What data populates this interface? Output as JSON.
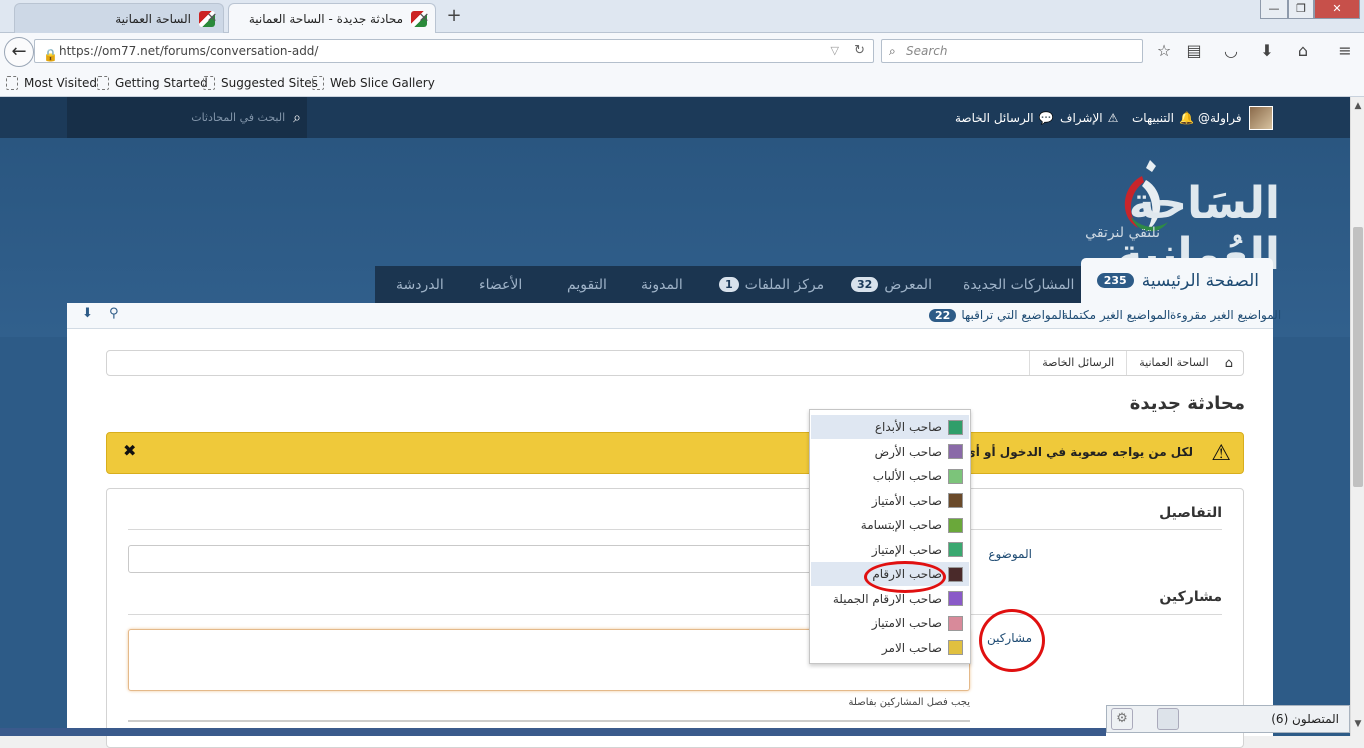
{
  "browser": {
    "tabs": [
      {
        "title": "الساحة العمانية",
        "active": false
      },
      {
        "title": "محادثة جديدة - الساحة العمانية",
        "active": true
      }
    ],
    "new_tab_symbol": "+",
    "window_controls": [
      "—",
      "❐",
      "✕"
    ],
    "url": "https://om77.net/forums/conversation-add/",
    "search_placeholder": "Search",
    "bookmarks": [
      "Most Visited",
      "Getting Started",
      "Suggested Sites",
      "Web Slice Gallery"
    ],
    "toolbar_icons": [
      "star-icon",
      "reading-list-icon",
      "pocket-icon",
      "download-icon",
      "home-icon",
      "menu-icon"
    ]
  },
  "forum": {
    "top_search_placeholder": "البحث في المحادثات",
    "top_links": {
      "username": "فراولة@",
      "notifications": "التنبيهات",
      "moderation": "الإشراف",
      "private_messages": "الرسائل الخاصة"
    },
    "logo": {
      "title": "السَاحة العُمانية",
      "tagline": "نلتقي لنرتقي"
    },
    "nav_tabs": [
      {
        "label": "الصفحة الرئيسية",
        "badge": "235"
      },
      {
        "label": "المشاركات الجديدة",
        "badge": ""
      },
      {
        "label": "المعرض",
        "badge": "32"
      },
      {
        "label": "مركز الملفات",
        "badge": "1"
      },
      {
        "label": "المدونة",
        "badge": ""
      },
      {
        "label": "التقويم",
        "badge": ""
      },
      {
        "label": "الأعضاء",
        "badge": ""
      },
      {
        "label": "الدردشة",
        "badge": ""
      }
    ],
    "sub_nav": [
      {
        "label": "المواضيع الغير مقروءة",
        "badge": ""
      },
      {
        "label": "المواضيع الغير مكتملة",
        "badge": ""
      },
      {
        "label": "المواضيع التي تراقبها",
        "badge": "22"
      }
    ],
    "breadcrumb": [
      "الساحة العمانية",
      "الرسائل الخاصة"
    ],
    "page_title": "محادثة جديدة",
    "notice": "لكل من يواجه صعوبة في الدخول أو أي إشكالية بإسم",
    "notice_close": "✖",
    "sections": {
      "details": "التفاصيل",
      "participants": "مشاركين"
    },
    "fields": {
      "subject_label": "الموضوع",
      "participants_label": "مشاركين",
      "participants_hint": "يجب فصل المشاركين بفاصلة"
    },
    "dropdown": [
      {
        "name": "صاحب الأبداع",
        "color": "#2f9e6a",
        "highlighted": true
      },
      {
        "name": "صاحب الأرض",
        "color": "#8a6aa8",
        "highlighted": false
      },
      {
        "name": "صاحب الألباب",
        "color": "#7cc47a",
        "highlighted": false
      },
      {
        "name": "صاحب الأمتياز",
        "color": "#6a4a2a",
        "highlighted": false
      },
      {
        "name": "صاحب الإبتسامة",
        "color": "#6aa83a",
        "highlighted": false
      },
      {
        "name": "صاحب الإمتياز",
        "color": "#3aa870",
        "highlighted": false
      },
      {
        "name": "صاحب الارقام",
        "color": "#4a2a2a",
        "highlighted": true
      },
      {
        "name": "صاحب الارقام الجميلة",
        "color": "#8a5ac8",
        "highlighted": false
      },
      {
        "name": "صاحب الامتياز",
        "color": "#d88a9a",
        "highlighted": false
      },
      {
        "name": "صاحب الامر",
        "color": "#e0c040",
        "highlighted": false
      }
    ],
    "online": "المتصلون (6)"
  },
  "colors": {
    "header_bg": "#2d5b87",
    "top_strip": "#1c3a59",
    "notice_bg": "#efc93a",
    "accent_red": "#e01010"
  }
}
